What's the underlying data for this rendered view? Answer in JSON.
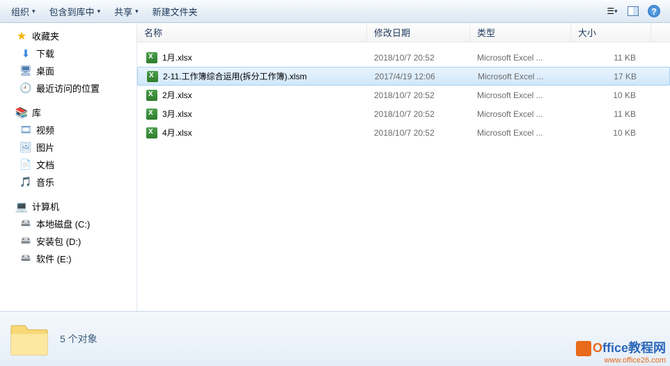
{
  "toolbar": {
    "organize": "组织",
    "include": "包含到库中",
    "share": "共享",
    "new_folder": "新建文件夹"
  },
  "sidebar": {
    "favorites": {
      "label": "收藏夹",
      "items": [
        "下载",
        "桌面",
        "最近访问的位置"
      ]
    },
    "libraries": {
      "label": "库",
      "items": [
        "视频",
        "图片",
        "文档",
        "音乐"
      ]
    },
    "computer": {
      "label": "计算机",
      "items": [
        "本地磁盘 (C:)",
        "安装包 (D:)",
        "软件 (E:)"
      ]
    }
  },
  "columns": {
    "name": "名称",
    "date": "修改日期",
    "type": "类型",
    "size": "大小"
  },
  "files": [
    {
      "name": "1月.xlsx",
      "date": "2018/10/7 20:52",
      "type": "Microsoft Excel ...",
      "size": "11 KB",
      "selected": false
    },
    {
      "name": "2-11.工作簿综合运用(拆分工作簿).xlsm",
      "date": "2017/4/19 12:06",
      "type": "Microsoft Excel ...",
      "size": "17 KB",
      "selected": true
    },
    {
      "name": "2月.xlsx",
      "date": "2018/10/7 20:52",
      "type": "Microsoft Excel ...",
      "size": "10 KB",
      "selected": false
    },
    {
      "name": "3月.xlsx",
      "date": "2018/10/7 20:52",
      "type": "Microsoft Excel ...",
      "size": "11 KB",
      "selected": false
    },
    {
      "name": "4月.xlsx",
      "date": "2018/10/7 20:52",
      "type": "Microsoft Excel ...",
      "size": "10 KB",
      "selected": false
    }
  ],
  "status": {
    "text": "5 个对象"
  },
  "watermark": {
    "title_o": "O",
    "title_rest": "ffice教程网",
    "url": "www.office26.com"
  }
}
